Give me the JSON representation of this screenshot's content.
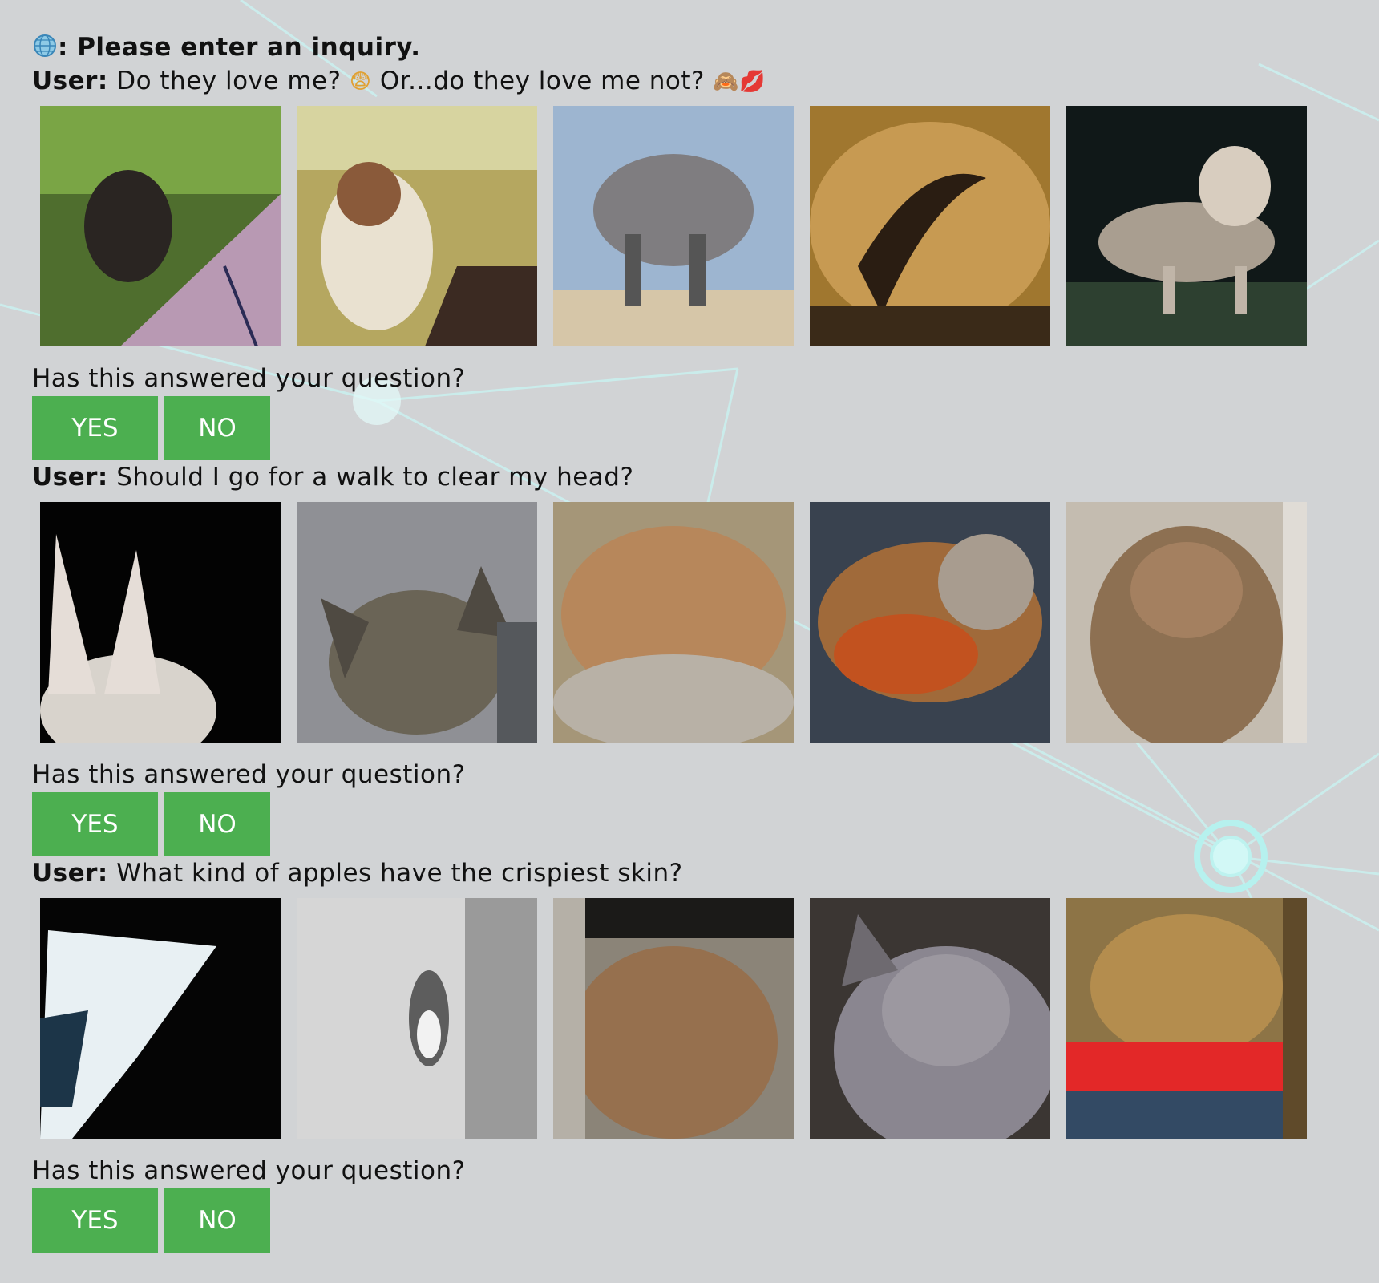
{
  "prompt": {
    "icon": "globe-icon",
    "text": ": Please enter an inquiry."
  },
  "entries": [
    {
      "user_label": "User:",
      "question_text": " Do they love me? ",
      "emoji_1": "😨",
      "question_text_2": " Or...do they love me not? ",
      "emoji_2": "🙈",
      "emoji_3": "💋",
      "images": [
        "cat-photo",
        "cat-photo",
        "cat-photo",
        "cat-photo",
        "cat-photo"
      ],
      "answered_label": "Has this answered your question?",
      "yes_label": "YES",
      "no_label": "NO"
    },
    {
      "user_label": "User:",
      "question_text": " Should I go for a walk to clear my head?",
      "images": [
        "cat-photo",
        "cat-photo",
        "cat-photo",
        "cat-photo",
        "cat-photo"
      ],
      "answered_label": "Has this answered your question?",
      "yes_label": "YES",
      "no_label": "NO"
    },
    {
      "user_label": "User:",
      "question_text": " What kind of apples have the crispiest skin?",
      "images": [
        "cat-photo",
        "cat-photo",
        "cat-photo",
        "cat-photo",
        "cat-photo"
      ],
      "answered_label": "Has this answered your question?",
      "yes_label": "YES",
      "no_label": "NO"
    }
  ],
  "colors": {
    "background": "#d1d3d5",
    "button": "#4caf50",
    "button_text": "#ffffff",
    "network_lines": "#bff6f4"
  }
}
